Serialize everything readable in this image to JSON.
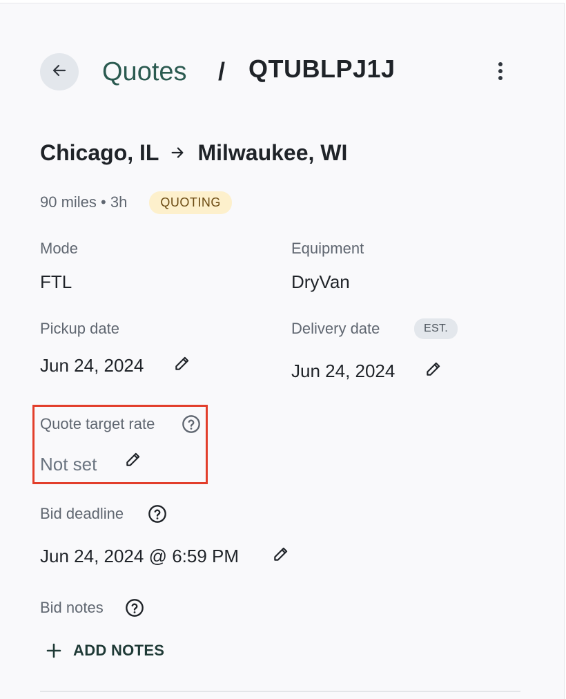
{
  "header": {
    "breadcrumb_parent": "Quotes",
    "breadcrumb_separator": "/",
    "quote_id": "QTUBLPJ1J"
  },
  "route": {
    "origin": "Chicago, IL",
    "destination": "Milwaukee, WI"
  },
  "meta": {
    "distance_duration": "90 miles • 3h",
    "status": "QUOTING"
  },
  "fields": {
    "mode_label": "Mode",
    "mode_value": "FTL",
    "equipment_label": "Equipment",
    "equipment_value": "DryVan",
    "pickup_label": "Pickup date",
    "pickup_value": "Jun 24, 2024",
    "delivery_label": "Delivery date",
    "delivery_badge": "EST.",
    "delivery_value": "Jun 24, 2024",
    "target_rate_label": "Quote target rate",
    "target_rate_value": "Not set",
    "bid_deadline_label": "Bid deadline",
    "bid_deadline_value": "Jun 24, 2024 @ 6:59 PM",
    "bid_notes_label": "Bid notes",
    "add_notes_label": "ADD NOTES"
  },
  "colors": {
    "accent": "#2b5a50",
    "highlight_border": "#e23e2b",
    "status_bg": "#fdf0cc"
  },
  "icons": [
    "arrow-left-icon",
    "more-vertical-icon",
    "arrow-right-icon",
    "pencil-icon",
    "help-circle-icon",
    "plus-icon"
  ]
}
